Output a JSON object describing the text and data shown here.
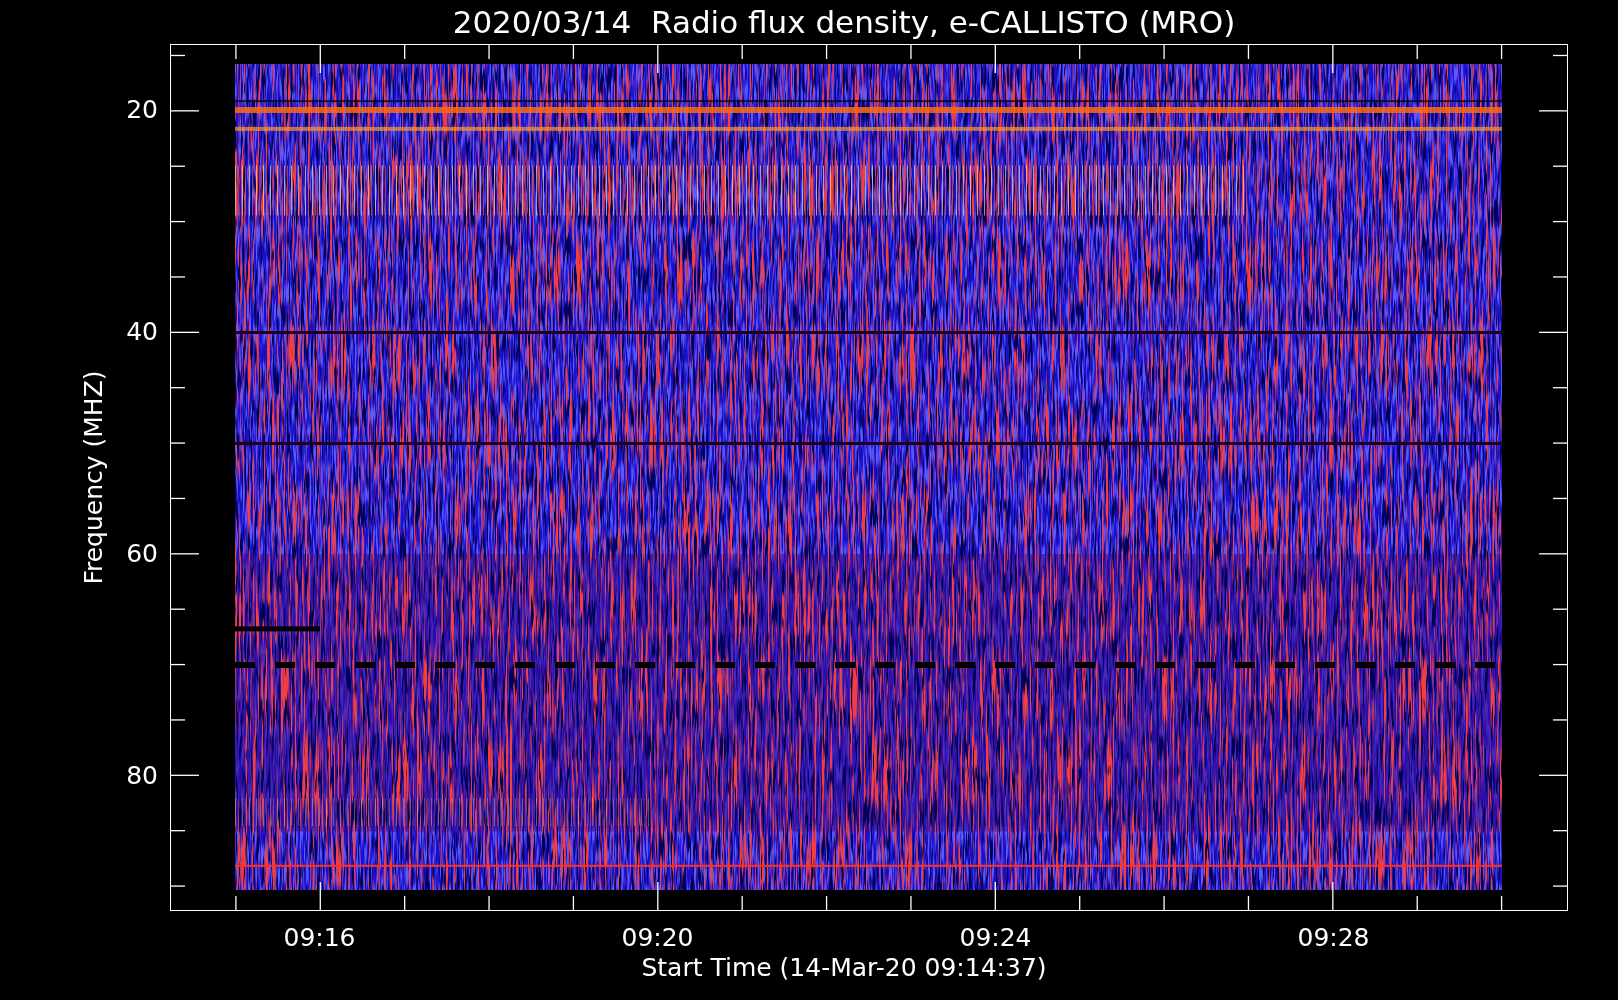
{
  "plot": {
    "title": "2020/03/14  Radio flux density, e-CALLISTO (MRO)",
    "y_axis": {
      "label": "Frequency (MHZ)",
      "ticks": [
        "20",
        "40",
        "60",
        "80"
      ]
    },
    "x_axis": {
      "label": "Start Time (14-Mar-20 09:14:37)",
      "ticks": [
        "09:16",
        "09:20",
        "09:24",
        "09:28"
      ]
    }
  }
}
